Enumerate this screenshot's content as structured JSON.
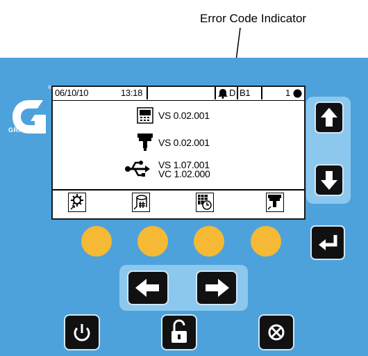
{
  "callout": {
    "label": "Error Code Indicator"
  },
  "brand": {
    "name": "GRACO",
    "registered": "®"
  },
  "status_bar": {
    "date": "06/10/10",
    "time": "13:18",
    "error_code": "D",
    "error_code_2": "B1",
    "job_number": "1"
  },
  "versions": {
    "display": "VS 0.02.001",
    "module": "VS 0.02.001",
    "usb_vs": "VS 1.07.001",
    "usb_vc": "VC 1.02.000"
  },
  "menu": {
    "icons": [
      "setup-gear-icon",
      "usb-log-icon",
      "schedule-icon",
      "module-icon"
    ]
  },
  "colors": {
    "panel": "#4ea2dc",
    "softkey": "#f5b935",
    "button": "#111111",
    "button_group": "#8cc8ee"
  }
}
